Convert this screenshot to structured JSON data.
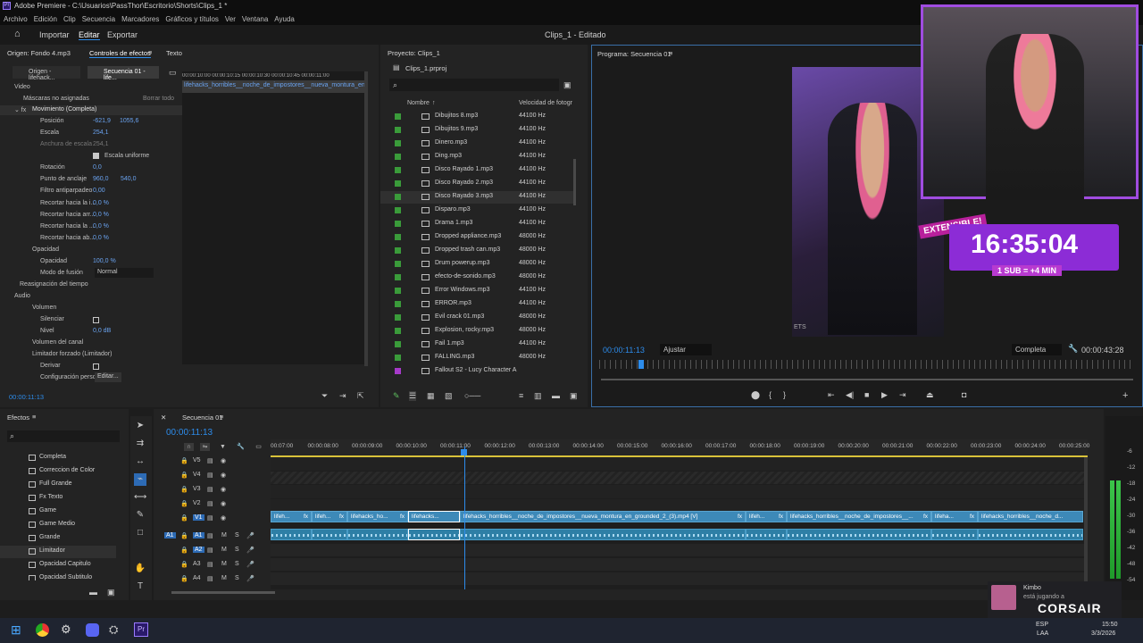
{
  "window": {
    "title": "Adobe Premiere - C:\\Usuarios\\PassThor\\Escritorio\\Shorts\\Clips_1 *"
  },
  "menu": [
    "Archivo",
    "Edición",
    "Clip",
    "Secuencia",
    "Marcadores",
    "Gráficos y títulos",
    "Ver",
    "Ventana",
    "Ayuda"
  ],
  "workspace": {
    "import": "Importar",
    "edit": "Editar",
    "export": "Exportar",
    "project_title": "Clips_1 - Editado"
  },
  "source_panel": {
    "tab_origin": "Origen: Fondo 4.mp3",
    "tab_effects": "Controles de efectos",
    "tab_text": "Texto",
    "sub_origin": "Origen - lifehack...",
    "sub_sequence": "Secuencia 01 - life...",
    "timestamps": "00:00:10:00  00:00:10:15  00:00:10:30  00:00:10:45  00:00:11:00",
    "clip_name": "lifehacks_horribles__noche_de_impostores__nueva_montura_en",
    "video_label": "Video",
    "masks_label": "Máscaras no asignadas",
    "delete_track": "Borrar todo",
    "rows": [
      {
        "label": "Movimiento (Completa)",
        "v1": "",
        "v2": ""
      },
      {
        "label": "Posición",
        "v1": "-621,9",
        "v2": "1055,6"
      },
      {
        "label": "Escala",
        "v1": "254,1",
        "v2": ""
      },
      {
        "label": "Anchura de escala",
        "v1": "254,1",
        "v2": ""
      },
      {
        "label": "Escala uniforme",
        "v1": "",
        "v2": ""
      },
      {
        "label": "Rotación",
        "v1": "0,0",
        "v2": ""
      },
      {
        "label": "Punto de anclaje",
        "v1": "960,0",
        "v2": "540,0"
      },
      {
        "label": "Filtro antiparpadeo",
        "v1": "0,00",
        "v2": ""
      },
      {
        "label": "Recortar hacia la i...",
        "v1": "0,0 %",
        "v2": ""
      },
      {
        "label": "Recortar hacia arr...",
        "v1": "0,0 %",
        "v2": ""
      },
      {
        "label": "Recortar hacia la ...",
        "v1": "0,0 %",
        "v2": ""
      },
      {
        "label": "Recortar hacia ab...",
        "v1": "0,0 %",
        "v2": ""
      },
      {
        "label": "Opacidad",
        "v1": "",
        "v2": ""
      },
      {
        "label": "Opacidad",
        "v1": "100,0 %",
        "v2": ""
      },
      {
        "label": "Modo de fusión",
        "v1": "Normal",
        "v2": ""
      },
      {
        "label": "Reasignación del tiempo",
        "v1": "",
        "v2": ""
      },
      {
        "label": "Audio",
        "v1": "",
        "v2": ""
      },
      {
        "label": "Volumen",
        "v1": "",
        "v2": ""
      },
      {
        "label": "Silenciar",
        "v1": "",
        "v2": ""
      },
      {
        "label": "Nivel",
        "v1": "0,0 dB",
        "v2": ""
      },
      {
        "label": "Volumen del canal",
        "v1": "",
        "v2": ""
      },
      {
        "label": "Limitador forzado (Limitador)",
        "v1": "",
        "v2": ""
      },
      {
        "label": "Derivar",
        "v1": "",
        "v2": ""
      },
      {
        "label": "Configuración perso",
        "v1": "Editar...",
        "v2": ""
      }
    ],
    "timecode": "00:00:11:13"
  },
  "project_panel": {
    "title": "Proyecto: Clips_1",
    "file": "Clips_1.prproj",
    "col_name": "Nombre",
    "col_rate": "Velocidad de fotogr",
    "items": [
      {
        "name": "Dibujitos 8.mp3",
        "rate": "44100 Hz"
      },
      {
        "name": "Dibujitos 9.mp3",
        "rate": "44100 Hz"
      },
      {
        "name": "Dinero.mp3",
        "rate": "44100 Hz"
      },
      {
        "name": "Ding.mp3",
        "rate": "44100 Hz"
      },
      {
        "name": "Disco Rayado 1.mp3",
        "rate": "44100 Hz"
      },
      {
        "name": "Disco Rayado 2.mp3",
        "rate": "44100 Hz"
      },
      {
        "name": "Disco Rayado 3.mp3",
        "rate": "44100 Hz"
      },
      {
        "name": "Disparo.mp3",
        "rate": "44100 Hz"
      },
      {
        "name": "Drama 1.mp3",
        "rate": "44100 Hz"
      },
      {
        "name": "Dropped appliance.mp3",
        "rate": "48000 Hz"
      },
      {
        "name": "Dropped trash can.mp3",
        "rate": "48000 Hz"
      },
      {
        "name": "Drum powerup.mp3",
        "rate": "48000 Hz"
      },
      {
        "name": "efecto-de-sonido.mp3",
        "rate": "48000 Hz"
      },
      {
        "name": "Error Windows.mp3",
        "rate": "44100 Hz"
      },
      {
        "name": "ERROR.mp3",
        "rate": "44100 Hz"
      },
      {
        "name": "Evil crack 01.mp3",
        "rate": "48000 Hz"
      },
      {
        "name": "Explosion, rocky.mp3",
        "rate": "48000 Hz"
      },
      {
        "name": "Fail 1.mp3",
        "rate": "44100 Hz"
      },
      {
        "name": "FALLING.mp3",
        "rate": "48000 Hz"
      },
      {
        "name": "Fallout S2 - Lucy Character A",
        "rate": ""
      }
    ]
  },
  "program_panel": {
    "title": "Programa: Secuencia 01",
    "timecode": "00:00:11:13",
    "fit": "Ajustar",
    "quality": "Completa",
    "duration": "00:00:43:28",
    "overlay": {
      "tag": "EXTENSIBLE!",
      "timer": "16:35:04",
      "sub": "1 SUB = +4 MIN",
      "stream_text": "ETS"
    }
  },
  "effects_panel": {
    "title": "Efectos",
    "items": [
      "Completa",
      "Correccion de Color",
      "Full Grande",
      "Fx Texto",
      "Game",
      "Game Medio",
      "Grande",
      "Limitador",
      "Opacidad Capitulo",
      "Opacidad Subtitulo"
    ]
  },
  "timeline": {
    "title": "Secuencia 01",
    "timecode": "00:00:11:13",
    "ruler": [
      "00:07:00",
      "00:00:08:00",
      "00:00:09:00",
      "00:00:10:00",
      "00:00:11:00",
      "00:00:12:00",
      "00:00:13:00",
      "00:00:14:00",
      "00:00:15:00",
      "00:00:16:00",
      "00:00:17:00",
      "00:00:18:00",
      "00:00:19:00",
      "00:00:20:00",
      "00:00:21:00",
      "00:00:22:00",
      "00:00:23:00",
      "00:00:24:00",
      "00:00:25:00"
    ],
    "video_tracks": [
      "V5",
      "V4",
      "V3",
      "V2",
      "V1"
    ],
    "audio_tracks": [
      "A1",
      "A2",
      "A3",
      "A4"
    ],
    "source_patch": "A1",
    "clips": [
      {
        "label": "lifeh...",
        "fx": "fx"
      },
      {
        "label": "lifeh...",
        "fx": "fx"
      },
      {
        "label": "lifehacks_ho...",
        "fx": "fx"
      },
      {
        "label": "lifehacks...",
        "fx": ""
      },
      {
        "label": "lifehacks_horribles__noche_de_impostores__nueva_montura_en_grounded_2_(3).mp4 [V]",
        "fx": "fx"
      },
      {
        "label": "lifeh...",
        "fx": "fx"
      },
      {
        "label": "lifehacks_horribles__noche_de_impostores__...",
        "fx": "fx"
      },
      {
        "label": "lifeha...",
        "fx": "fx"
      },
      {
        "label": "lifehacks_horribles__noche_d...",
        "fx": ""
      }
    ],
    "mute": "M",
    "solo": "S"
  },
  "meter_ticks": [
    "-6",
    "-12",
    "-18",
    "-24",
    "-30",
    "-36",
    "-42",
    "-48",
    "-54"
  ],
  "notification": {
    "name": "Kimbo",
    "text": "está jugando a",
    "brand": "CORSAIR"
  },
  "taskbar": {
    "lang": "ESP",
    "lang2": "LAA",
    "time": "15:50",
    "date": "3/3/2026"
  },
  "colors": {
    "accent": "#3d89b8",
    "timecode": "#2d8ceb",
    "project_check": "#3a9b3a",
    "overlay_purple": "#8c2cd6"
  }
}
